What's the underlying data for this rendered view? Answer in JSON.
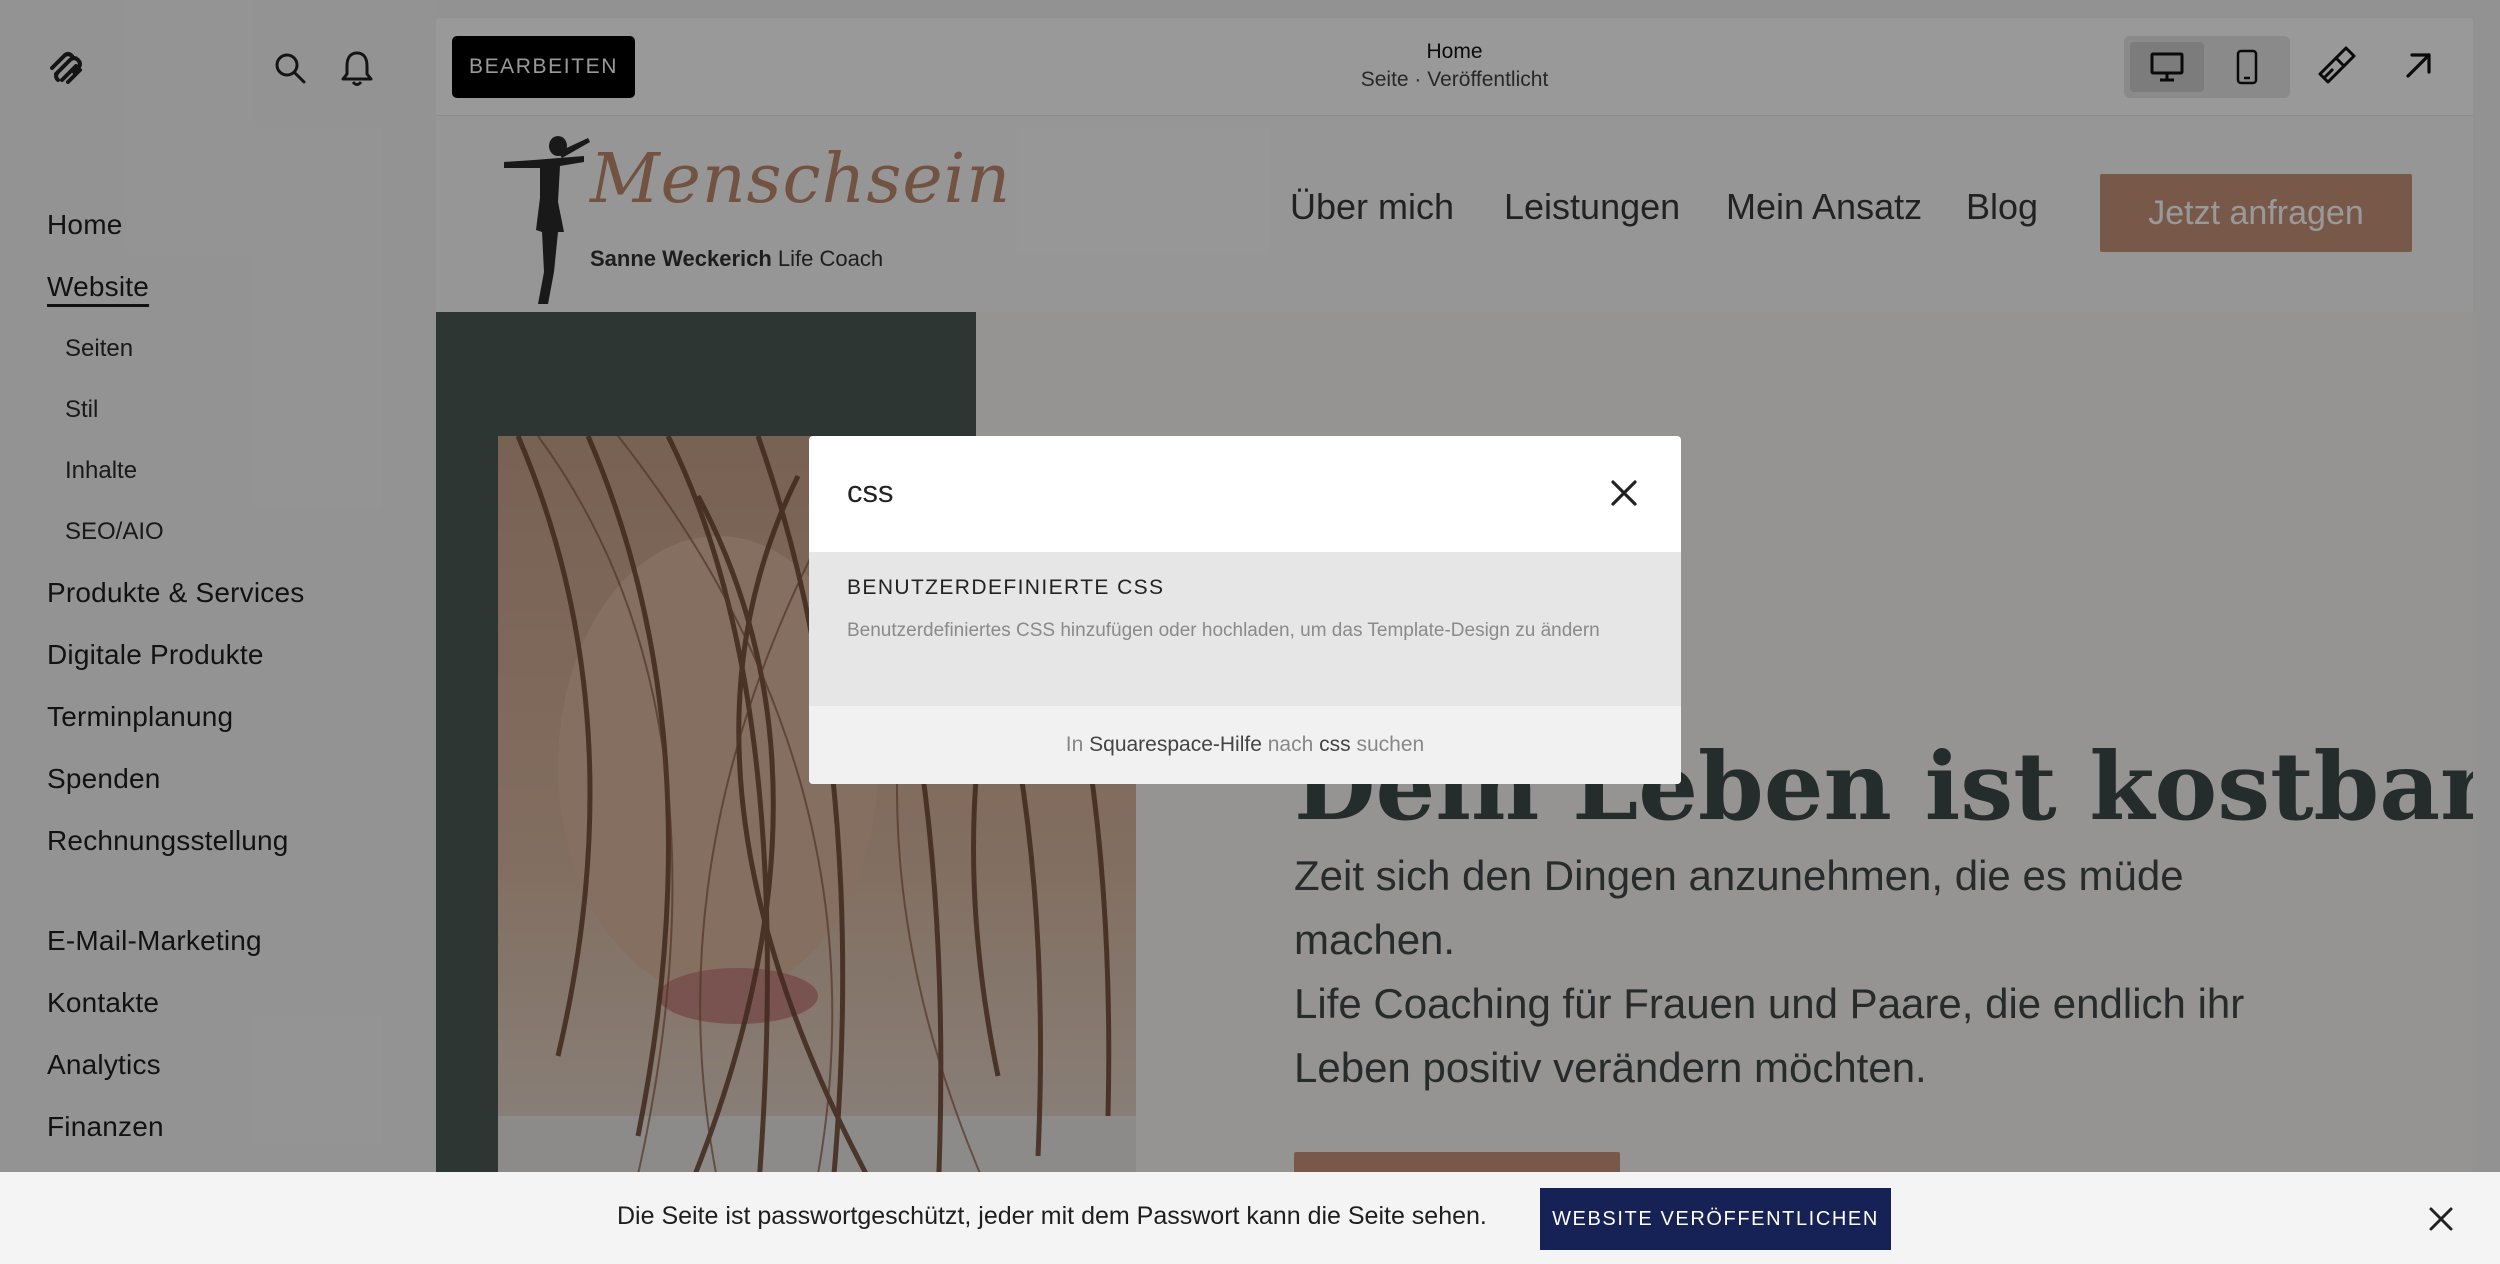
{
  "sidebar": {
    "nav": [
      {
        "label": "Home"
      },
      {
        "label": "Website",
        "active": true
      },
      {
        "label": "Seiten",
        "sub": true
      },
      {
        "label": "Stil",
        "sub": true
      },
      {
        "label": "Inhalte",
        "sub": true
      },
      {
        "label": "SEO/AIO",
        "sub": true
      },
      {
        "label": "Produkte & Services"
      },
      {
        "label": "Digitale Produkte"
      },
      {
        "label": "Terminplanung"
      },
      {
        "label": "Spenden"
      },
      {
        "label": "Rechnungsstellung"
      },
      {
        "label": "E-Mail-Marketing"
      },
      {
        "label": "Kontakte"
      },
      {
        "label": "Analytics"
      },
      {
        "label": "Finanzen"
      }
    ],
    "icons": [
      "squarespace-logo",
      "search-icon",
      "bell-icon"
    ]
  },
  "topbar": {
    "edit_label": "BEARBEITEN",
    "title": "Home",
    "subtitle": "Seite · Veröffentlicht",
    "icons": [
      "desktop-icon",
      "mobile-icon",
      "brush-icon",
      "external-arrow-icon"
    ]
  },
  "site": {
    "logo_script": "Menschsein",
    "logo_name": "Sanne Weckerich",
    "logo_role": "Life Coach",
    "nav": [
      "Über mich",
      "Leistungen",
      "Mein Ansatz",
      "Blog"
    ],
    "cta": "Jetzt anfragen",
    "headline": "Dein Leben ist kostbar.",
    "text_line1": "Zeit sich den Dingen anzunehmen, die es müde machen.",
    "text_line2": "Life Coaching für Frauen und Paare, die endlich ihr Leben positiv verändern möchten."
  },
  "modal": {
    "search_value": "css",
    "result_title": "BENUTZERDEFINIERTE CSS",
    "result_desc": "Benutzerdefiniertes CSS hinzufügen oder hochladen, um das Template-Design zu ändern",
    "help_prefix": "In",
    "help_source": "Squarespace-Hilfe",
    "help_mid": "nach",
    "help_term": "css",
    "help_suffix": "suchen"
  },
  "banner": {
    "text": "Die Seite ist passwortgeschützt, jeder mit dem Passwort kann die Seite sehen.",
    "button": "WEBSITE VERÖFFENTLICHEN"
  },
  "colors": {
    "accent": "#c8957b",
    "publish_button": "#162255",
    "dark_panel": "#4e5b55"
  }
}
